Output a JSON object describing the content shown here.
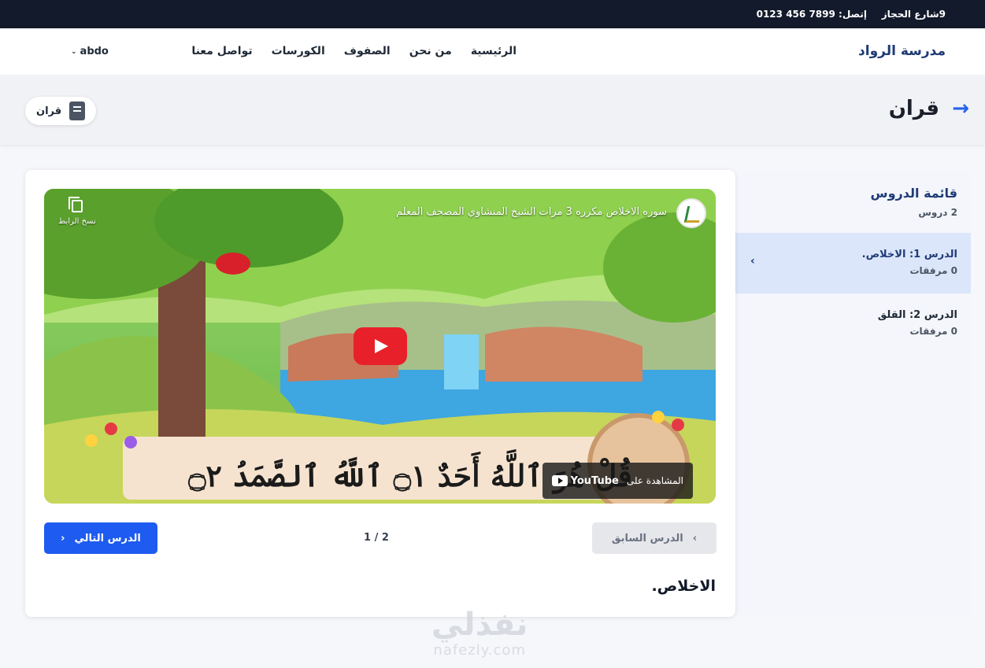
{
  "topbar": {
    "address": "9شارع الحجاز",
    "phone": "إتصل: 7899 456 0123"
  },
  "navbar": {
    "brand": "مدرسة الرواد",
    "links": [
      "الرئيسية",
      "من نحن",
      "الصفوف",
      "الكورسات",
      "تواصل معنا"
    ],
    "user": "abdo"
  },
  "page_header": {
    "title": "قران",
    "category": "قران"
  },
  "sidebar": {
    "title": "قائمة الدروس",
    "count": "2 دروس",
    "lessons": [
      {
        "title": "الدرس 1: الاخلاص.",
        "attachments": "0 مرفقات"
      },
      {
        "title": "الدرس 2: القلق",
        "attachments": "0 مرفقات"
      }
    ]
  },
  "video": {
    "title": "سوره الاخلاص مكرره 3 مرات الشيخ المنشاوي المصحف المعلم",
    "copy_link_label": "نسخ الرابط",
    "watch_on": "المشاهدة على",
    "youtube": "YouTube",
    "verse_text": "قُلْ هُوَ ٱللَّهُ أَحَدٌ ۝١ ٱللَّهُ ٱلصَّمَدُ ۝٢"
  },
  "pager": {
    "prev_label": "الدرس السابق",
    "next_label": "الدرس التالي",
    "counter": "1 / 2"
  },
  "lesson_heading": "الاخلاص.",
  "watermark": {
    "ar": "نفذلي",
    "en": "nafezly.com"
  },
  "colors": {
    "topbar": "#121a2b",
    "brand": "#1f3b76",
    "accent": "#1e5bf0",
    "active_lesson": "#dbe6fb",
    "youtube_red": "#e8202a"
  }
}
